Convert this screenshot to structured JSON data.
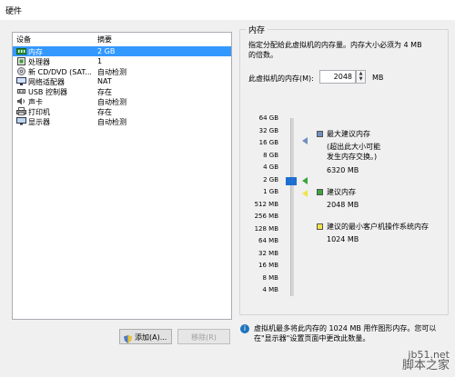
{
  "window": {
    "title": "硬件"
  },
  "device_list": {
    "headers": {
      "device": "设备",
      "summary": "摘要"
    },
    "rows": [
      {
        "name": "内存",
        "value": "2 GB",
        "icon": "memory-icon",
        "selected": true
      },
      {
        "name": "处理器",
        "value": "1",
        "icon": "cpu-icon",
        "selected": false
      },
      {
        "name": "新 CD/DVD (SAT...",
        "value": "自动检测",
        "icon": "cd-icon",
        "selected": false
      },
      {
        "name": "网络适配器",
        "value": "NAT",
        "icon": "network-icon",
        "selected": false
      },
      {
        "name": "USB 控制器",
        "value": "存在",
        "icon": "usb-icon",
        "selected": false
      },
      {
        "name": "声卡",
        "value": "自动检测",
        "icon": "sound-icon",
        "selected": false
      },
      {
        "name": "打印机",
        "value": "存在",
        "icon": "printer-icon",
        "selected": false
      },
      {
        "name": "显示器",
        "value": "自动检测",
        "icon": "display-icon",
        "selected": false
      }
    ]
  },
  "buttons": {
    "add": "添加(A)...",
    "remove": "移除(R)"
  },
  "memory_panel": {
    "title": "内存",
    "description": "指定分配给此虚拟机的内存量。内存大小必须为 4 MB 的倍数。",
    "memory_label": "此虚拟机的内存(M):",
    "memory_value": "2048",
    "unit": "MB",
    "scale_ticks": [
      "64 GB",
      "32 GB",
      "16 GB",
      "8 GB",
      "4 GB",
      "2 GB",
      "1 GB",
      "512 MB",
      "256 MB",
      "128 MB",
      "64 MB",
      "32 MB",
      "16 MB",
      "8 MB",
      "4 MB"
    ],
    "legend": {
      "max_recommended_title": "最大建议内存",
      "max_recommended_note": "(超出此大小可能\n发生内存交换。)",
      "max_recommended_value": "6320 MB",
      "recommended_title": "建议内存",
      "recommended_value": "2048 MB",
      "min_guest_title": "建议的最小客户机操作系统内存",
      "min_guest_value": "1024 MB"
    },
    "colors": {
      "max": "#6f8fbf",
      "recommended": "#3aa53a",
      "min": "#f2e24a",
      "thumb": "#1f6fd1"
    },
    "info_text": "虚拟机最多将此内存的 1024 MB 用作图形内存。您可以在\"显示器\"设置页面中更改此数量。"
  },
  "watermark": {
    "line1": "jb51.net",
    "line2": "脚本之家"
  }
}
